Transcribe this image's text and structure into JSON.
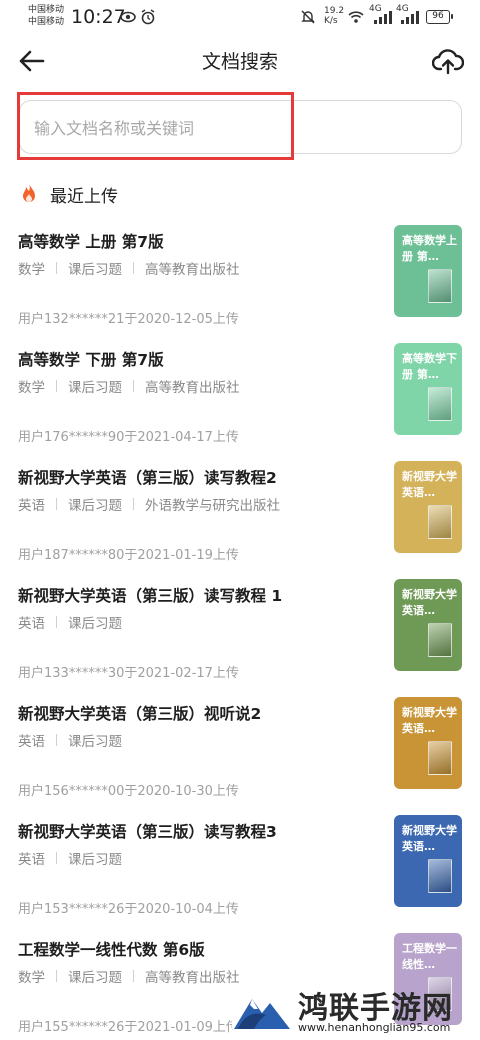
{
  "status_bar": {
    "carrier_1": "中国移动",
    "carrier_2": "中国移动",
    "time": "10:27",
    "net_speed": "19.2",
    "net_unit": "K/s",
    "signal_1": "4G",
    "signal_2": "4G",
    "battery": "96"
  },
  "header": {
    "title": "文档搜索",
    "back_icon": "arrow-left-icon",
    "upload_icon": "cloud-upload-icon"
  },
  "search": {
    "placeholder": "输入文档名称或关键词",
    "value": "",
    "highlight_color": "#e53a3a"
  },
  "section": {
    "title": "最近上传",
    "icon": "fire-icon",
    "icon_color": "#f2642a"
  },
  "documents": [
    {
      "title": "高等数学 上册 第7版",
      "tags": [
        "数学",
        "课后习题",
        "高等教育出版社"
      ],
      "meta": "用户132******21于2020-12-05上传",
      "thumb_label": "高等数学上册 第…",
      "thumb_color": "#6dbf96"
    },
    {
      "title": "高等数学 下册 第7版",
      "tags": [
        "数学",
        "课后习题",
        "高等教育出版社"
      ],
      "meta": "用户176******90于2021-04-17上传",
      "thumb_label": "高等数学下册 第…",
      "thumb_color": "#7fd4a8"
    },
    {
      "title": "新视野大学英语（第三版）读写教程2",
      "tags": [
        "英语",
        "课后习题",
        "外语教学与研究出版社"
      ],
      "meta": "用户187******80于2021-01-19上传",
      "thumb_label": "新视野大学英语…",
      "thumb_color": "#d4b25a"
    },
    {
      "title": "新视野大学英语（第三版）读写教程 1",
      "tags": [
        "英语",
        "课后习题"
      ],
      "meta": "用户133******30于2021-02-17上传",
      "thumb_label": "新视野大学英语…",
      "thumb_color": "#6f9a55"
    },
    {
      "title": "新视野大学英语（第三版）视听说2",
      "tags": [
        "英语",
        "课后习题"
      ],
      "meta": "用户156******00于2020-10-30上传",
      "thumb_label": "新视野大学英语…",
      "thumb_color": "#c99436"
    },
    {
      "title": "新视野大学英语（第三版）读写教程3",
      "tags": [
        "英语",
        "课后习题"
      ],
      "meta": "用户153******26于2020-10-04上传",
      "thumb_label": "新视野大学英语…",
      "thumb_color": "#3b68b0"
    },
    {
      "title": "工程数学一线性代数 第6版",
      "tags": [
        "数学",
        "课后习题",
        "高等教育出版社"
      ],
      "meta": "用户155******26于2021-01-09上传",
      "thumb_label": "工程数学一线性…",
      "thumb_color": "#b7a3cc"
    }
  ],
  "watermark": {
    "name": "鸿联手游网",
    "url": "www.henanhonglian95.com"
  }
}
